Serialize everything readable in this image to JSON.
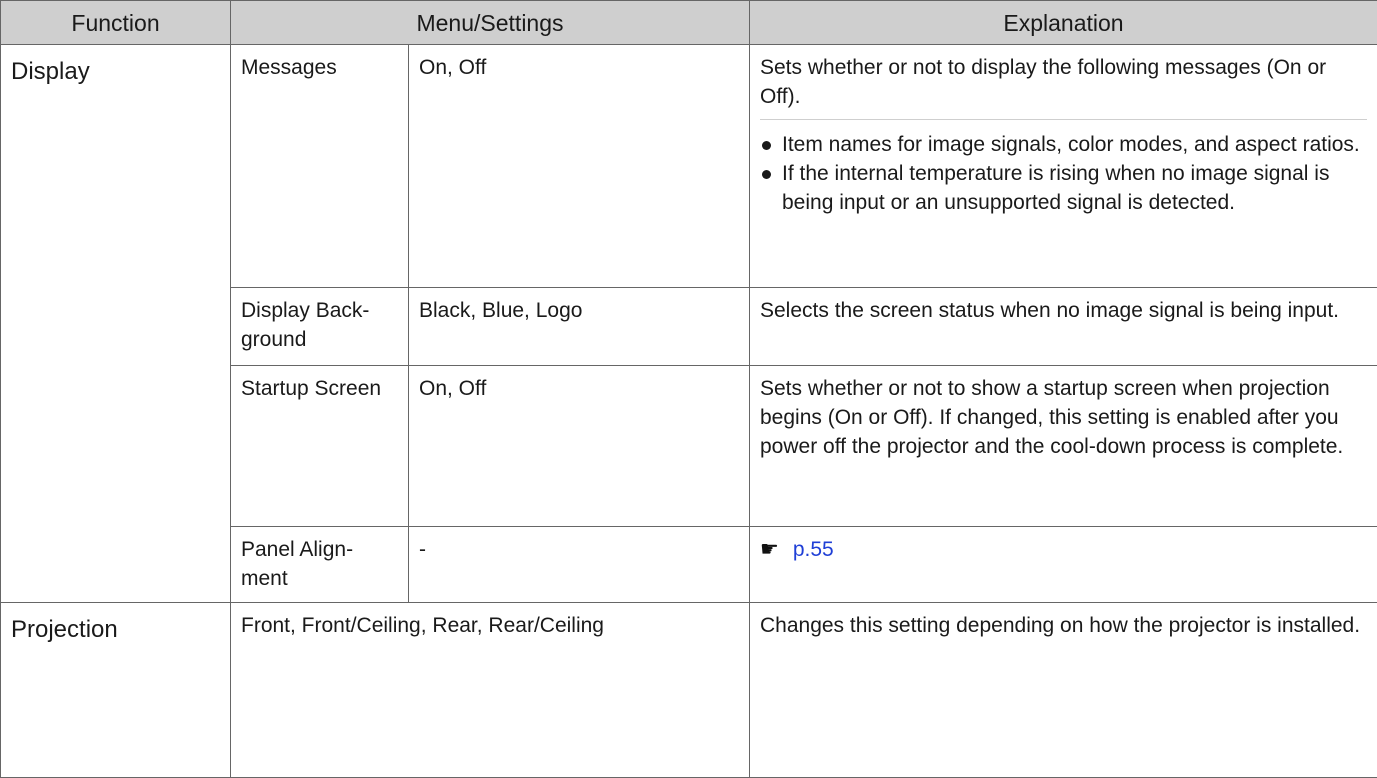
{
  "headers": {
    "function": "Function",
    "menu_settings": "Menu/Settings",
    "explanation": "Explanation"
  },
  "display": {
    "function": "Display",
    "rows": [
      {
        "menu": "Messages",
        "settings": "On, Off",
        "explanation": "Sets whether or not to display the following messages (On or Off).",
        "bullets": [
          "Item names for image signals, color modes, and aspect ratios.",
          "If the internal temperature is rising when no image signal is being input or an unsupported signal is detected."
        ]
      },
      {
        "menu": "Display Back-ground",
        "settings": "Black, Blue, Logo",
        "explanation": "Selects the screen status when no image signal is being input."
      },
      {
        "menu": "Startup Screen",
        "settings": "On, Off",
        "explanation": "Sets whether or not to show a startup screen when projection begins (On or Off). If changed, this setting is enabled after you power off the projector and the cool-down process is complete."
      },
      {
        "menu": "Panel Align-ment",
        "settings": "-",
        "icon": "pointing-hand-icon",
        "link": "p.55"
      }
    ]
  },
  "projection": {
    "function": "Projection",
    "settings": "Front, Front/Ceiling, Rear, Rear/Ceiling",
    "explanation": "Changes this setting depending on how the projector is installed."
  },
  "colors": {
    "header_background": "#cfcfcf",
    "border": "#666666",
    "link": "#1f3fd6"
  }
}
